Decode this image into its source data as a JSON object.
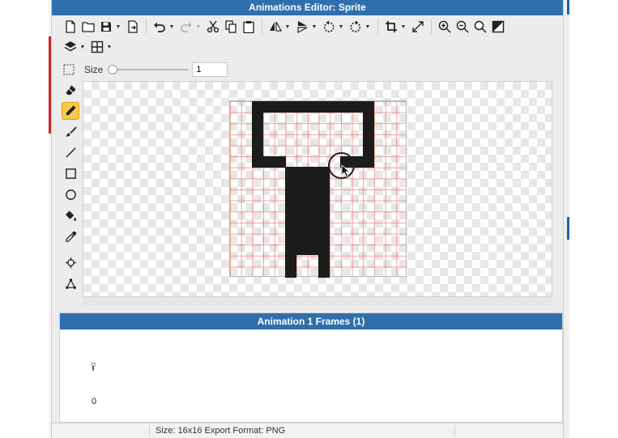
{
  "window": {
    "title": "Animations Editor: Sprite"
  },
  "toolbar_row_1": [
    {
      "icon": "new-file-icon"
    },
    {
      "icon": "open-folder-icon"
    },
    {
      "icon": "save-icon",
      "dropdown": true
    },
    {
      "icon": "export-icon"
    },
    {
      "icon": "undo-icon",
      "dropdown": true
    },
    {
      "icon": "redo-icon",
      "dropdown": true,
      "disabled": true
    },
    {
      "icon": "cut-icon"
    },
    {
      "icon": "copy-icon"
    },
    {
      "icon": "paste-icon"
    },
    {
      "icon": "flip-horizontal-icon",
      "dropdown": true
    },
    {
      "icon": "flip-vertical-icon",
      "dropdown": true
    },
    {
      "icon": "rotate-ccw-icon",
      "dropdown": true
    },
    {
      "icon": "rotate-cw-icon",
      "dropdown": true
    },
    {
      "icon": "crop-icon",
      "dropdown": true
    },
    {
      "icon": "resize-icon"
    },
    {
      "icon": "zoom-in-icon"
    },
    {
      "icon": "zoom-out-icon"
    },
    {
      "icon": "zoom-fit-icon"
    },
    {
      "icon": "toggle-background-icon"
    }
  ],
  "toolbar_row_2": [
    {
      "icon": "layers-icon",
      "dropdown": true
    },
    {
      "icon": "grid-icon",
      "dropdown": true
    }
  ],
  "size_control": {
    "label": "Size",
    "value": "1"
  },
  "tools": [
    {
      "icon": "eraser-icon",
      "active": false
    },
    {
      "icon": "pencil-icon",
      "active": true
    },
    {
      "icon": "brush-icon",
      "active": false
    },
    {
      "icon": "line-icon",
      "active": false
    },
    {
      "icon": "rectangle-icon",
      "active": false
    },
    {
      "icon": "ellipse-icon",
      "active": false
    },
    {
      "icon": "fill-bucket-icon",
      "active": false
    },
    {
      "icon": "eyedropper-icon",
      "active": false
    },
    {
      "icon": "move-origin-icon",
      "active": false
    },
    {
      "icon": "transform-points-icon",
      "active": false
    }
  ],
  "sprite": {
    "width": 16,
    "height": 16,
    "pixel_color": "#1c1c1c",
    "grid_color": "#e85850",
    "rows": [
      "..###########...",
      "..#.........#...",
      "..#.........#...",
      "..#.........#...",
      "..#.........#...",
      "..###.....###...",
      ".....####.......",
      ".....####.......",
      ".....####.......",
      ".....####.......",
      ".....####.......",
      ".....####.......",
      ".....####.......",
      ".....####.......",
      ".....#..#.......",
      ".....#..#......."
    ]
  },
  "frames_panel": {
    "title": "Animation 1 Frames (1)",
    "frames": [
      {
        "index": "0"
      }
    ]
  },
  "status_bar": {
    "text": "Size: 16x16   Export Format: PNG"
  },
  "colors": {
    "title_bar": "#2f6fad",
    "active_tool": "#f5c94a"
  }
}
